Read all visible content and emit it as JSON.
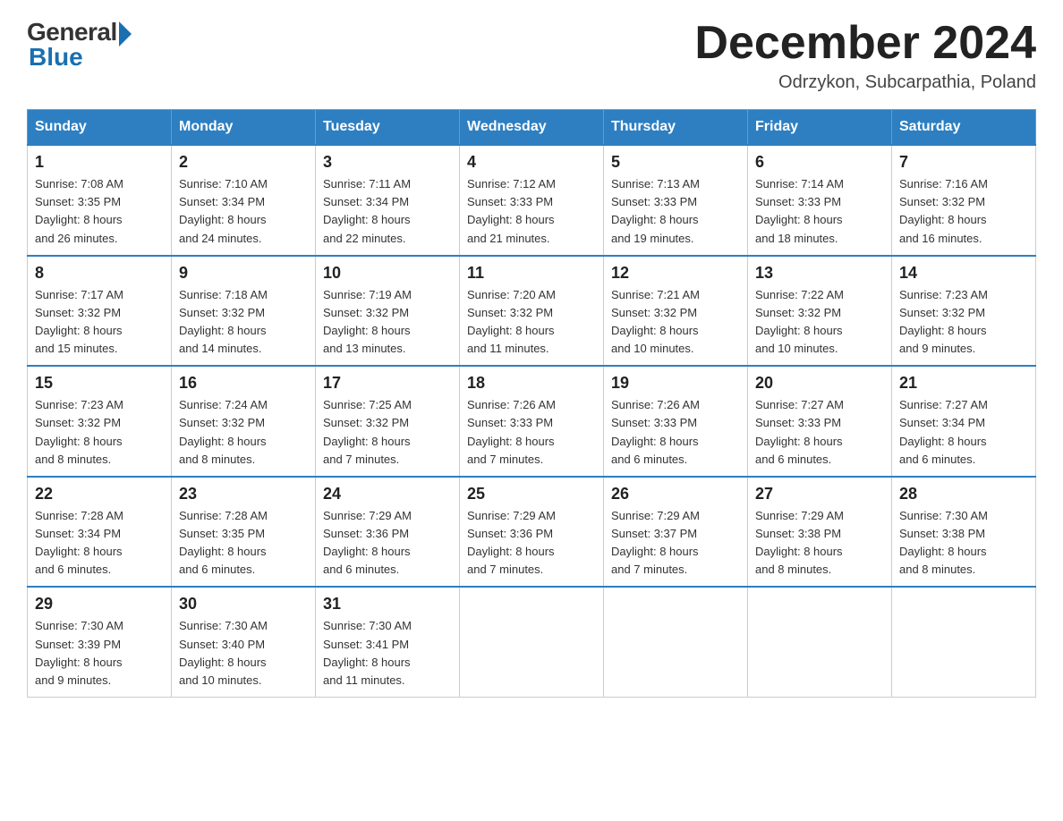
{
  "header": {
    "logo_general": "General",
    "logo_blue": "Blue",
    "title": "December 2024",
    "subtitle": "Odrzykon, Subcarpathia, Poland"
  },
  "days_of_week": [
    "Sunday",
    "Monday",
    "Tuesday",
    "Wednesday",
    "Thursday",
    "Friday",
    "Saturday"
  ],
  "weeks": [
    [
      {
        "day": "1",
        "sunrise": "7:08 AM",
        "sunset": "3:35 PM",
        "daylight": "8 hours and 26 minutes."
      },
      {
        "day": "2",
        "sunrise": "7:10 AM",
        "sunset": "3:34 PM",
        "daylight": "8 hours and 24 minutes."
      },
      {
        "day": "3",
        "sunrise": "7:11 AM",
        "sunset": "3:34 PM",
        "daylight": "8 hours and 22 minutes."
      },
      {
        "day": "4",
        "sunrise": "7:12 AM",
        "sunset": "3:33 PM",
        "daylight": "8 hours and 21 minutes."
      },
      {
        "day": "5",
        "sunrise": "7:13 AM",
        "sunset": "3:33 PM",
        "daylight": "8 hours and 19 minutes."
      },
      {
        "day": "6",
        "sunrise": "7:14 AM",
        "sunset": "3:33 PM",
        "daylight": "8 hours and 18 minutes."
      },
      {
        "day": "7",
        "sunrise": "7:16 AM",
        "sunset": "3:32 PM",
        "daylight": "8 hours and 16 minutes."
      }
    ],
    [
      {
        "day": "8",
        "sunrise": "7:17 AM",
        "sunset": "3:32 PM",
        "daylight": "8 hours and 15 minutes."
      },
      {
        "day": "9",
        "sunrise": "7:18 AM",
        "sunset": "3:32 PM",
        "daylight": "8 hours and 14 minutes."
      },
      {
        "day": "10",
        "sunrise": "7:19 AM",
        "sunset": "3:32 PM",
        "daylight": "8 hours and 13 minutes."
      },
      {
        "day": "11",
        "sunrise": "7:20 AM",
        "sunset": "3:32 PM",
        "daylight": "8 hours and 11 minutes."
      },
      {
        "day": "12",
        "sunrise": "7:21 AM",
        "sunset": "3:32 PM",
        "daylight": "8 hours and 10 minutes."
      },
      {
        "day": "13",
        "sunrise": "7:22 AM",
        "sunset": "3:32 PM",
        "daylight": "8 hours and 10 minutes."
      },
      {
        "day": "14",
        "sunrise": "7:23 AM",
        "sunset": "3:32 PM",
        "daylight": "8 hours and 9 minutes."
      }
    ],
    [
      {
        "day": "15",
        "sunrise": "7:23 AM",
        "sunset": "3:32 PM",
        "daylight": "8 hours and 8 minutes."
      },
      {
        "day": "16",
        "sunrise": "7:24 AM",
        "sunset": "3:32 PM",
        "daylight": "8 hours and 8 minutes."
      },
      {
        "day": "17",
        "sunrise": "7:25 AM",
        "sunset": "3:32 PM",
        "daylight": "8 hours and 7 minutes."
      },
      {
        "day": "18",
        "sunrise": "7:26 AM",
        "sunset": "3:33 PM",
        "daylight": "8 hours and 7 minutes."
      },
      {
        "day": "19",
        "sunrise": "7:26 AM",
        "sunset": "3:33 PM",
        "daylight": "8 hours and 6 minutes."
      },
      {
        "day": "20",
        "sunrise": "7:27 AM",
        "sunset": "3:33 PM",
        "daylight": "8 hours and 6 minutes."
      },
      {
        "day": "21",
        "sunrise": "7:27 AM",
        "sunset": "3:34 PM",
        "daylight": "8 hours and 6 minutes."
      }
    ],
    [
      {
        "day": "22",
        "sunrise": "7:28 AM",
        "sunset": "3:34 PM",
        "daylight": "8 hours and 6 minutes."
      },
      {
        "day": "23",
        "sunrise": "7:28 AM",
        "sunset": "3:35 PM",
        "daylight": "8 hours and 6 minutes."
      },
      {
        "day": "24",
        "sunrise": "7:29 AM",
        "sunset": "3:36 PM",
        "daylight": "8 hours and 6 minutes."
      },
      {
        "day": "25",
        "sunrise": "7:29 AM",
        "sunset": "3:36 PM",
        "daylight": "8 hours and 7 minutes."
      },
      {
        "day": "26",
        "sunrise": "7:29 AM",
        "sunset": "3:37 PM",
        "daylight": "8 hours and 7 minutes."
      },
      {
        "day": "27",
        "sunrise": "7:29 AM",
        "sunset": "3:38 PM",
        "daylight": "8 hours and 8 minutes."
      },
      {
        "day": "28",
        "sunrise": "7:30 AM",
        "sunset": "3:38 PM",
        "daylight": "8 hours and 8 minutes."
      }
    ],
    [
      {
        "day": "29",
        "sunrise": "7:30 AM",
        "sunset": "3:39 PM",
        "daylight": "8 hours and 9 minutes."
      },
      {
        "day": "30",
        "sunrise": "7:30 AM",
        "sunset": "3:40 PM",
        "daylight": "8 hours and 10 minutes."
      },
      {
        "day": "31",
        "sunrise": "7:30 AM",
        "sunset": "3:41 PM",
        "daylight": "8 hours and 11 minutes."
      },
      null,
      null,
      null,
      null
    ]
  ],
  "labels": {
    "sunrise": "Sunrise:",
    "sunset": "Sunset:",
    "daylight": "Daylight:"
  }
}
